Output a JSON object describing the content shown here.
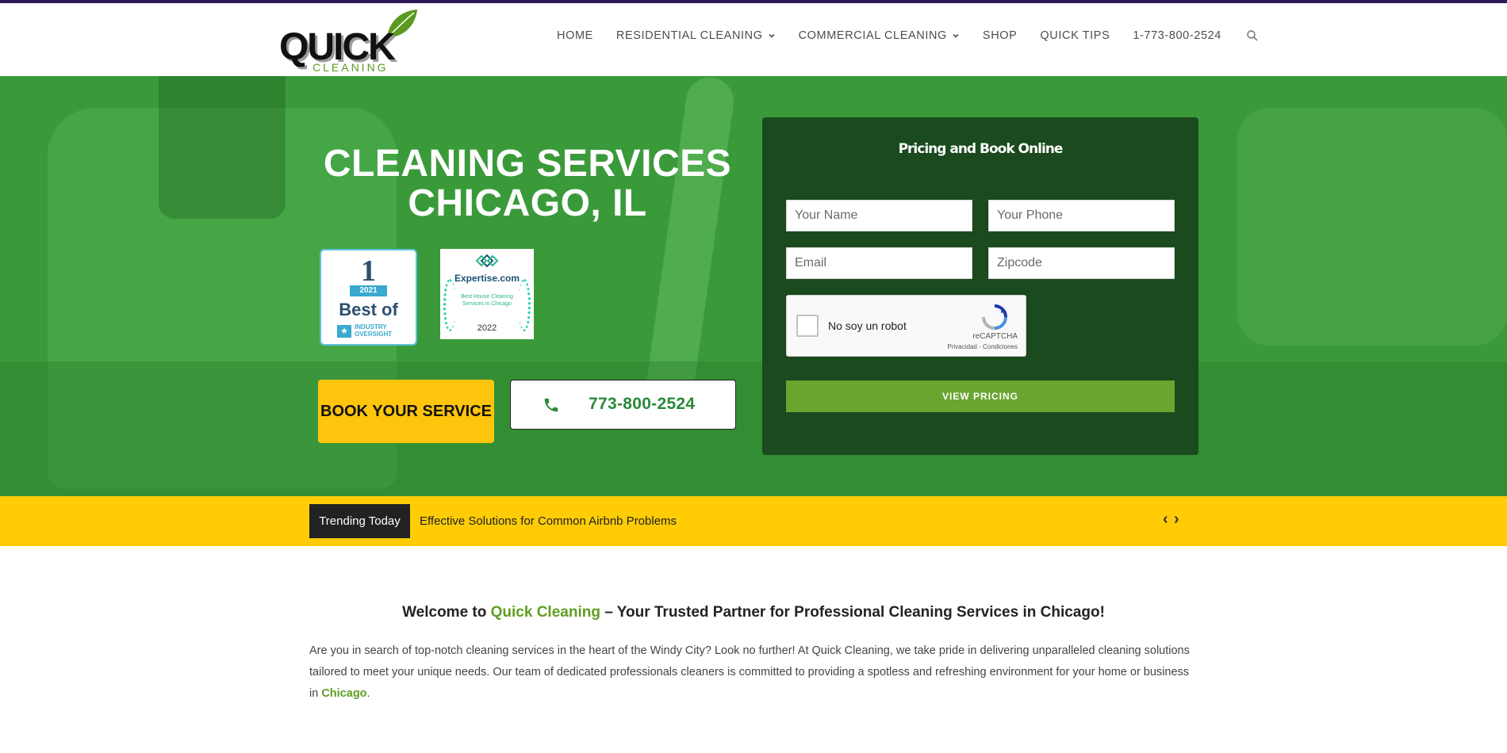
{
  "brand": {
    "logo_main": "QUICK",
    "logo_sub": "CLEANING",
    "leaf_color": "#5a9a1e"
  },
  "nav": {
    "items": [
      {
        "label": "HOME",
        "has_dropdown": false
      },
      {
        "label": "RESIDENTIAL CLEANING",
        "has_dropdown": true
      },
      {
        "label": "COMMERCIAL CLEANING",
        "has_dropdown": true
      },
      {
        "label": "SHOP",
        "has_dropdown": false
      },
      {
        "label": "QUICK TIPS",
        "has_dropdown": false
      },
      {
        "label": "1-773-800-2524",
        "has_dropdown": false
      }
    ],
    "search_icon": "search-icon"
  },
  "hero": {
    "title_line1": "CLEANING SERVICES",
    "title_line2": "CHICAGO, IL",
    "badge_industry": {
      "rank": "1",
      "year": "2021",
      "best": "Best of",
      "source_line1": "INDUSTRY",
      "source_line2": "OVERSIGHT"
    },
    "badge_expertise": {
      "name": "Expertise.com",
      "text": "Best House Cleaning Services in Chicago",
      "year": "2022"
    },
    "book_button": "BOOK YOUR SERVICE",
    "phone_button": "773-800-2524"
  },
  "form": {
    "title": "Pricing and Book Online",
    "name_placeholder": "Your Name",
    "phone_placeholder": "Your Phone",
    "email_placeholder": "Email",
    "zip_placeholder": "Zipcode",
    "captcha_label": "No soy un robot",
    "captcha_brand": "reCAPTCHA",
    "captcha_links": "Privacidad - Condiciones",
    "submit_label": "VIEW PRICING"
  },
  "trending": {
    "label": "Trending Today",
    "headline": "Effective Solutions for Common Airbnb Problems"
  },
  "content": {
    "welcome_prefix": "Welcome to ",
    "welcome_brand": "Quick Cleaning",
    "welcome_suffix": " – Your Trusted Partner for Professional Cleaning Services in Chicago!",
    "paragraph_main": "Are you in search of top-notch cleaning services in the heart of the Windy City? Look no further! At Quick Cleaning, we take pride in delivering unparalleled cleaning solutions tailored to meet your unique needs. Our team of dedicated professionals cleaners is committed to providing a spotless and refreshing environment for your home or business in ",
    "paragraph_link": "Chicago",
    "paragraph_end": "."
  },
  "colors": {
    "accent_green": "#5f9e22",
    "hero_green": "#3a9a3a",
    "form_bg": "#1a4a1d",
    "yellow": "#ffcc05",
    "button_green": "#6aa530"
  }
}
